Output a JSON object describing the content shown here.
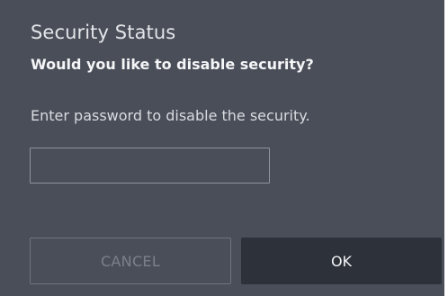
{
  "dialog": {
    "title": "Security Status",
    "question": "Would you like to disable security?",
    "instruction": "Enter password to disable the security.",
    "password_field": {
      "value": "",
      "placeholder": ""
    },
    "buttons": {
      "cancel_label": "CANCEL",
      "ok_label": "OK"
    }
  },
  "colors": {
    "dialog_background": "#4a4e58",
    "ok_button_background": "#2d313a",
    "cancel_text_disabled": "#7b808a"
  }
}
